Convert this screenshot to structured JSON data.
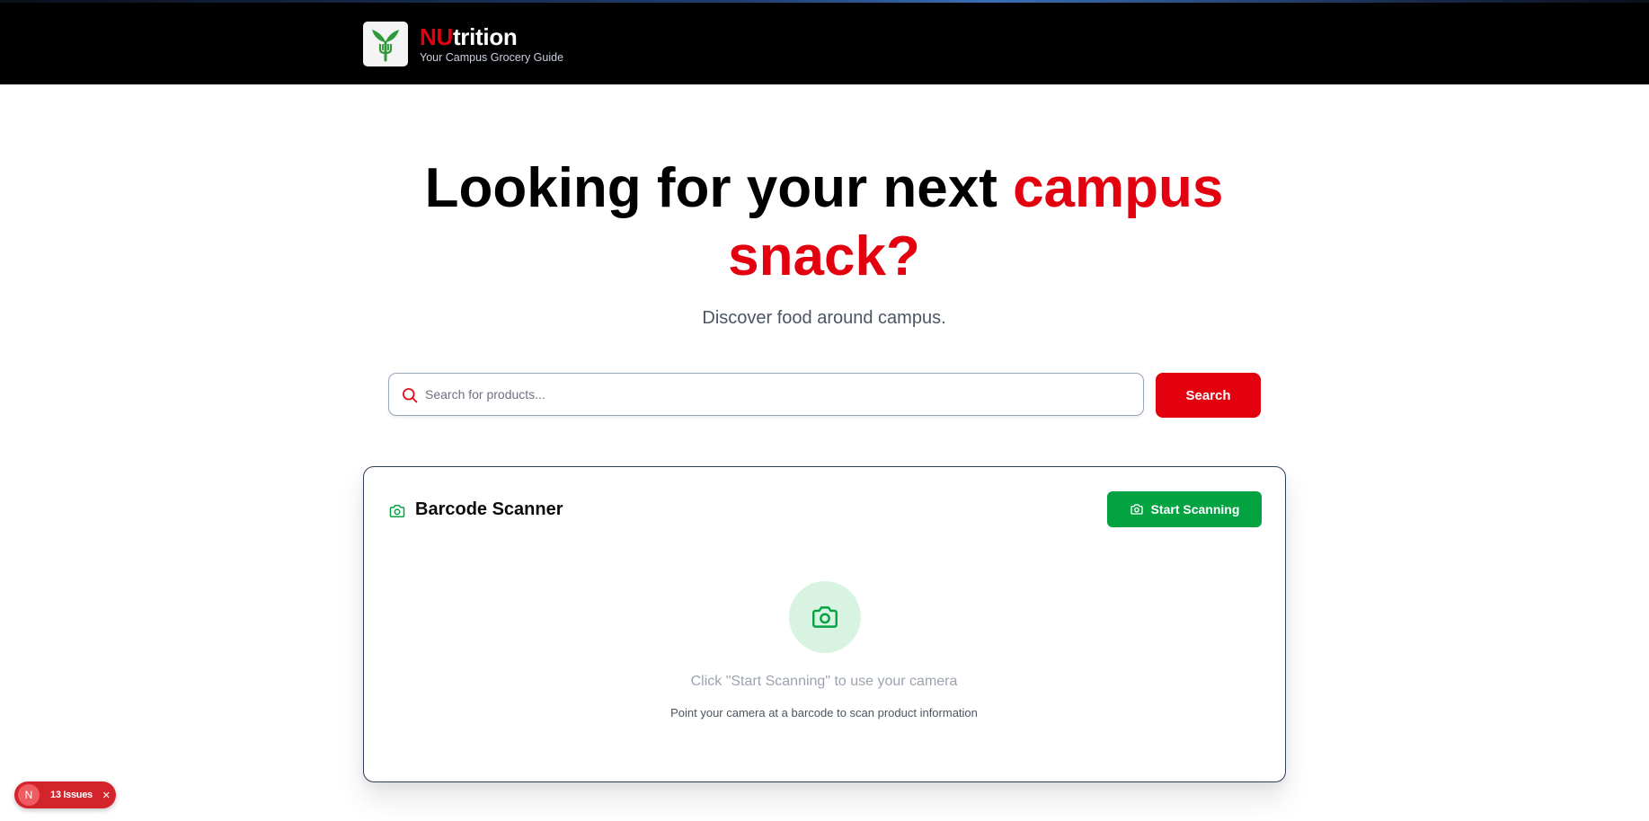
{
  "header": {
    "brand_accent": "NU",
    "brand_rest": "trition",
    "tagline": "Your Campus Grocery Guide",
    "logo_icon": "sprout-fork-icon"
  },
  "hero": {
    "title_plain": "Looking for your next ",
    "title_accent": "campus snack?",
    "subtitle": "Discover food around campus."
  },
  "search": {
    "placeholder": "Search for products...",
    "value": "",
    "button_label": "Search",
    "icon": "search-icon"
  },
  "scanner": {
    "title": "Barcode Scanner",
    "start_button_label": "Start Scanning",
    "hint": "Click \"Start Scanning\" to use your camera",
    "note": "Point your camera at a barcode to scan product information",
    "icon": "camera-icon"
  },
  "dev_overlay": {
    "badge_letter": "N",
    "issues_label": "13 Issues",
    "close_glyph": "×"
  },
  "colors": {
    "brand_red": "#e3000f",
    "scan_green": "#04a342",
    "header_bg": "#000000",
    "issues_red": "#d4242b"
  }
}
